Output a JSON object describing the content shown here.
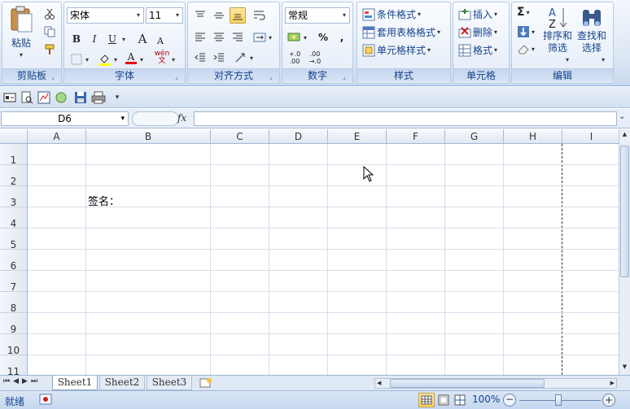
{
  "ribbon": {
    "clipboard": {
      "label": "剪贴板",
      "paste": "粘贴"
    },
    "font": {
      "label": "字体",
      "font_name": "宋体",
      "font_size": "11",
      "bold": "B",
      "italic": "I",
      "underline": "U",
      "grow": "A",
      "shrink": "A",
      "phonetic": "wén\n文"
    },
    "alignment": {
      "label": "对齐方式"
    },
    "number": {
      "label": "数字",
      "format": "常规",
      "percent": "%",
      "comma": ",",
      "inc": "+.0\n.00",
      "dec": ".00\n→.0"
    },
    "styles": {
      "label": "样式",
      "conditional": "条件格式",
      "table": "套用表格格式",
      "cell": "单元格样式"
    },
    "cells": {
      "label": "单元格",
      "insert": "插入",
      "delete": "删除",
      "format": "格式"
    },
    "editing": {
      "label": "编辑",
      "sum": "Σ",
      "sort1": "排序和",
      "sort2": "筛选",
      "find1": "查找和",
      "find2": "选择"
    }
  },
  "formula_bar": {
    "name_box": "D6",
    "fx": "fx",
    "value": ""
  },
  "columns": [
    "A",
    "B",
    "C",
    "D",
    "E",
    "F",
    "G",
    "H",
    "I"
  ],
  "rows": [
    "1",
    "2",
    "3",
    "4",
    "5",
    "6",
    "7",
    "8",
    "9",
    "10",
    "11"
  ],
  "cells": {
    "B3": "签名："
  },
  "sheets": [
    "Sheet1",
    "Sheet2",
    "Sheet3"
  ],
  "status": {
    "ready": "就绪",
    "zoom": "100%"
  }
}
